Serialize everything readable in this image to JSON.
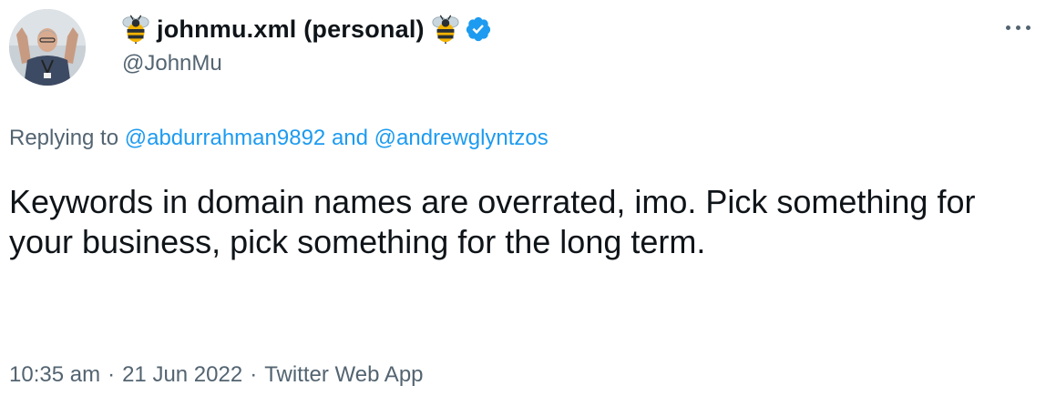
{
  "tweet": {
    "display_name": "johnmu.xml (personal)",
    "handle": "@JohnMu",
    "left_emoji": "bee-icon",
    "right_emoji": "bee-icon",
    "verified_badge": "verified-badge-icon",
    "more_icon": "more-horizontal-icon",
    "replying_prefix": "Replying to",
    "reply_to_1": "@abdurrahman9892",
    "reply_joiner": "and",
    "reply_to_2": "@andrewglyntzos",
    "text": "Keywords in domain names are overrated, imo. Pick something for your business, pick something for the long term.",
    "time": "10:35 am",
    "separator_1": "·",
    "date": "21 Jun 2022",
    "separator_2": "·",
    "client": "Twitter Web App"
  },
  "colors": {
    "link": "#1d9bf0",
    "secondary_text": "#536471",
    "primary_text": "#0f1419",
    "verified": "#1d9bf0"
  }
}
